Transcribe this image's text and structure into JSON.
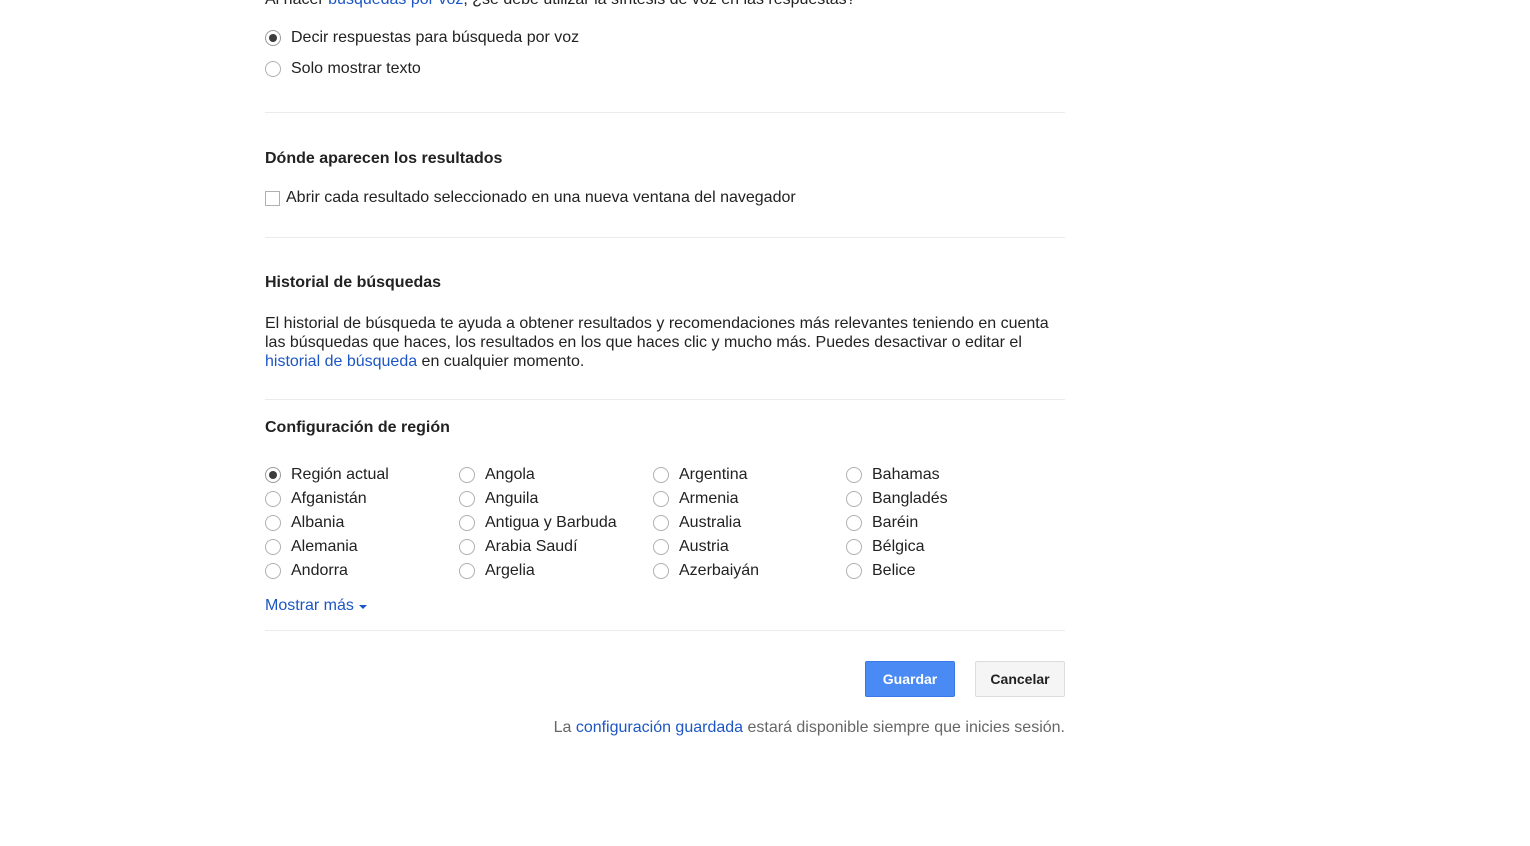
{
  "voice": {
    "intro_prefix": "Al hacer ",
    "intro_link": "búsquedas por voz",
    "intro_suffix": ", ¿se debe utilizar la síntesis de voz en las respuestas?",
    "options": [
      {
        "label": "Decir respuestas para búsqueda por voz",
        "checked": true
      },
      {
        "label": "Solo mostrar texto",
        "checked": false
      }
    ]
  },
  "results_location": {
    "title": "Dónde aparecen los resultados",
    "checkbox_label": "Abrir cada resultado seleccionado en una nueva ventana del navegador",
    "checked": false
  },
  "history": {
    "title": "Historial de búsquedas",
    "text_before": "El historial de búsqueda te ayuda a obtener resultados y recomendaciones más relevantes teniendo en cuenta las búsquedas que haces, los resultados en los que haces clic y mucho más. Puedes desactivar o editar el ",
    "link": "historial de búsqueda",
    "text_after": " en cualquier momento."
  },
  "region": {
    "title": "Configuración de región",
    "columns": [
      [
        "Región actual",
        "Afganistán",
        "Albania",
        "Alemania",
        "Andorra"
      ],
      [
        "Angola",
        "Anguila",
        "Antigua y Barbuda",
        "Arabia Saudí",
        "Argelia"
      ],
      [
        "Argentina",
        "Armenia",
        "Australia",
        "Austria",
        "Azerbaiyán"
      ],
      [
        "Bahamas",
        "Bangladés",
        "Baréin",
        "Bélgica",
        "Belice"
      ]
    ],
    "selected": "Región actual",
    "show_more": "Mostrar más"
  },
  "actions": {
    "save": "Guardar",
    "cancel": "Cancelar"
  },
  "footer": {
    "prefix": "La ",
    "link": "configuración guardada",
    "suffix": " estará disponible siempre que inicies sesión."
  }
}
